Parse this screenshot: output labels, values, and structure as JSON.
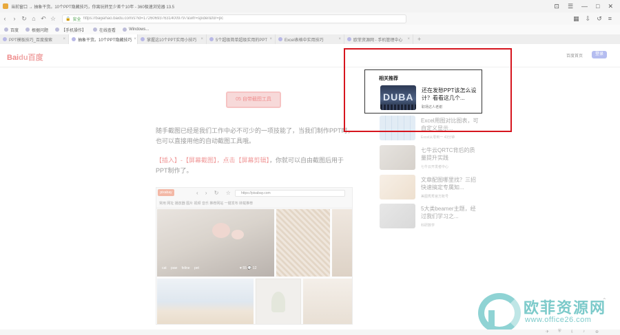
{
  "browser": {
    "window_title": "当前窗口 → 抽象干货。10个PPT隐藏技巧，你离玩转至少差个10年 - 360极速浏览器 13.5",
    "win_controls": [
      "⊡",
      "☰",
      "—",
      "□",
      "✕"
    ],
    "address": {
      "safe_label": "安全",
      "url": "https://baijiahao.baidu.com/s?id=1726069376314009797&wfr=spider&for=pc"
    },
    "bookmarks": [
      "百度",
      "根据问题",
      "【手机操作】",
      "在线查看",
      "Windows..."
    ],
    "tabs": [
      {
        "label": "PPT模板技巧_百度搜索",
        "active": false
      },
      {
        "label": "抽象干货。10个PPT隐藏技巧",
        "active": true
      },
      {
        "label": "掌握这10个PPT实用小技巧",
        "active": false
      },
      {
        "label": "5个超级简单超级实用的PPT",
        "active": false
      },
      {
        "label": "Excel表格中实用技巧",
        "active": false
      },
      {
        "label": "欧菲资源网 - 手机管理中心",
        "active": false
      }
    ],
    "new_tab": "+"
  },
  "site": {
    "logo_text": "Bai",
    "logo_paw": "du百度",
    "home_link": "百度首页",
    "login_button": "登录"
  },
  "article": {
    "section_heading": "05 自带截图工具",
    "para1": "随手截图已经是我们工作中必不可少的一项技能了，当我们制作PPT时，也可以直接用他的自动截图工具哦。",
    "para2_prefix": "【插入】-【屏幕截图】，点击【屏幕剪辑】",
    "para2_suffix": "，你就可以自由截图后用于PPT制作了。",
    "embedded": {
      "logo": "pixabay",
      "nav_icons": "‹ › ↻ ☆",
      "url": "https://pixabay.com",
      "bookmarks": "常用  网址  播放器  图片  视频  音乐  推荐网站  一键发布  转载推荐",
      "image_tags": "cat  paw  feline  pet",
      "image_stats": "♥ 55   💬 12"
    }
  },
  "recommend": {
    "title": "相关推荐",
    "first": {
      "thumb_text": "DUBA",
      "title": "还在发愁PPT该怎么设计？看看这几个...",
      "source": "职场达人老谢"
    },
    "items": [
      {
        "title": "Excel用图对比图表，可自定义显示...",
        "source": "Excel从零到一  43分钟"
      },
      {
        "title": "七牛云QRTC背后的质量提升实践",
        "source": "七牛云开发者中心"
      },
      {
        "title": "文章配图哪里找？三招快速搞定专属知...",
        "source": "美图秀秀官方账号"
      },
      {
        "title": "5大类beamer主题，经过我们学习之...",
        "source": "科研数学"
      }
    ]
  },
  "watermark": {
    "title": "欧菲资源网",
    "url": "www.office26.com"
  },
  "colors": {
    "highlight_box": "#d6141d",
    "accent_pink": "#f08e8e",
    "watermark": "#7ccaca"
  }
}
